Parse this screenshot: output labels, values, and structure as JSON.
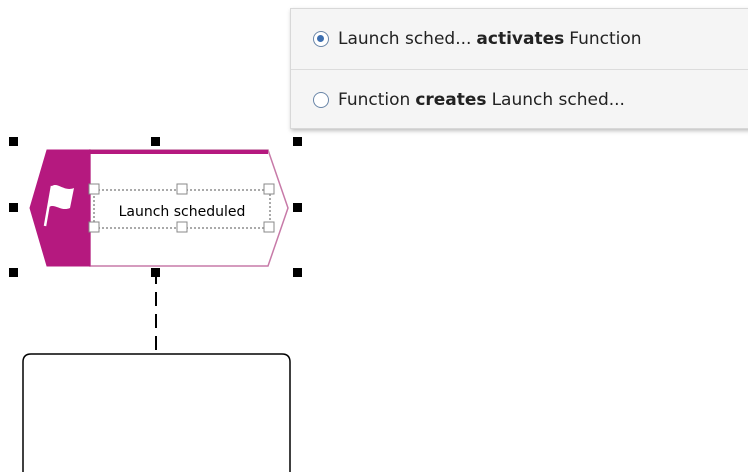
{
  "diagram": {
    "event": {
      "label": "Launch scheduled",
      "icon": "flag-icon",
      "color": "#b5197f",
      "border_color": "#c77aa8"
    },
    "function_box": {
      "label": ""
    }
  },
  "relationship_menu": {
    "options": [
      {
        "source": "Launch sched...",
        "relation": "activates",
        "target": "Function",
        "selected": true
      },
      {
        "source": "Function",
        "relation": "creates",
        "target": "Launch sched...",
        "selected": false
      }
    ]
  }
}
